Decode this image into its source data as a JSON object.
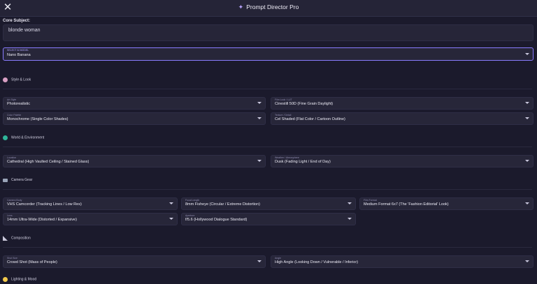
{
  "header": {
    "title": "Prompt Director Pro",
    "close_icon": "close-icon",
    "title_icon": "magic-wand-icon"
  },
  "core": {
    "label": "Core Subject:",
    "value": "blonde woman"
  },
  "model": {
    "label": "SELECT AI MODEL",
    "value": "Nano Banana"
  },
  "sections": {
    "style": {
      "title": "Style & Look",
      "icon": "palette-icon"
    },
    "world": {
      "title": "World & Environment",
      "icon": "globe-icon"
    },
    "camera": {
      "title": "Camera Gear",
      "icon": "camera-icon"
    },
    "composition": {
      "title": "Composition",
      "icon": "set-square-icon"
    },
    "lighting": {
      "title": "Lighting & Mood",
      "icon": "lightbulb-icon"
    }
  },
  "fields": {
    "art_style": {
      "label": "Art Style",
      "value": "Photorealistic"
    },
    "film_look": {
      "label": "Film Look / LUT",
      "value": "Cinestill 50D (Fine Grain Daylight)"
    },
    "color_palette": {
      "label": "Color Palette",
      "value": "Monochrome (Single Color Shades)"
    },
    "texture": {
      "label": "Texture / Detail",
      "value": "Cel Shaded (Flat Color / Cartoon Outline)"
    },
    "location": {
      "label": "Location",
      "value": "Cathedral (High Vaulted Ceiling / Stained Glass)"
    },
    "weather": {
      "label": "Weather / Atmosphere",
      "value": "Dusk (Fading Light / End of Day)"
    },
    "camera_body": {
      "label": "Camera Body",
      "value": "VHS Camcorder (Tracking Lines / Low Res)"
    },
    "focal_length": {
      "label": "Focal Length",
      "value": "8mm Fisheye (Circular / Extreme Distortion)"
    },
    "film_format": {
      "label": "Film Format",
      "value": "Medium Format 6x7 (The 'Fashion Editorial' Look)"
    },
    "lens": {
      "label": "Lens",
      "value": "14mm Ultra-Wide (Distorted / Expansive)"
    },
    "aperture": {
      "label": "Aperture",
      "value": "f/5.6 (Hollywood Dialogue Standard)"
    },
    "shot_size": {
      "label": "Shot Size",
      "value": "Crowd Shot (Mass of People)"
    },
    "angle": {
      "label": "Angle",
      "value": "High Angle (Looking Down / Vulnerable / Inferior)"
    }
  },
  "colors": {
    "background": "#1b1a2c",
    "accent": "#8a7cff"
  }
}
